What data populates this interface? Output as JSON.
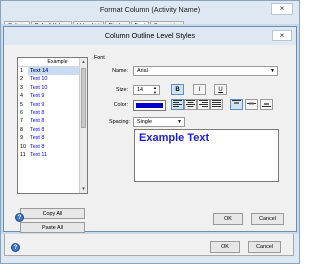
{
  "outer": {
    "title": "Format Column (Activity Name)",
    "close_glyph": "×",
    "tabs": [
      "Options",
      "Default Values",
      "Value List",
      "Display",
      "Font",
      "Summaries"
    ],
    "ok_label": "OK",
    "cancel_label": "Cancel"
  },
  "dialog": {
    "title": "Column Outline Level Styles",
    "close_glyph": "×",
    "list_header": "Example",
    "levels": [
      {
        "num": "1",
        "example": "Text 14"
      },
      {
        "num": "2",
        "example": "Text 10"
      },
      {
        "num": "3",
        "example": "Text 10"
      },
      {
        "num": "4",
        "example": "Text 9"
      },
      {
        "num": "5",
        "example": "Text 9"
      },
      {
        "num": "6",
        "example": "Text 8"
      },
      {
        "num": "7",
        "example": "Text 8"
      },
      {
        "num": "8",
        "example": "Text 8"
      },
      {
        "num": "9",
        "example": "Text 8"
      },
      {
        "num": "10",
        "example": "Text 8"
      },
      {
        "num": "11",
        "example": "Text 11"
      }
    ],
    "copy_all": "Copy All",
    "paste_all": "Paste All",
    "font_group": "Font",
    "name_label": "Name:",
    "name_value": "Arial",
    "size_label": "Size:",
    "size_value": "14",
    "bold": "B",
    "italic": "I",
    "underline": "U",
    "color_label": "Color:",
    "color_value": "#0000cc",
    "spacing_label": "Spacing:",
    "spacing_value": "Single",
    "preview_text": "Example Text",
    "ok_label": "OK",
    "cancel_label": "Cancel"
  },
  "icons": {
    "help": "?"
  }
}
